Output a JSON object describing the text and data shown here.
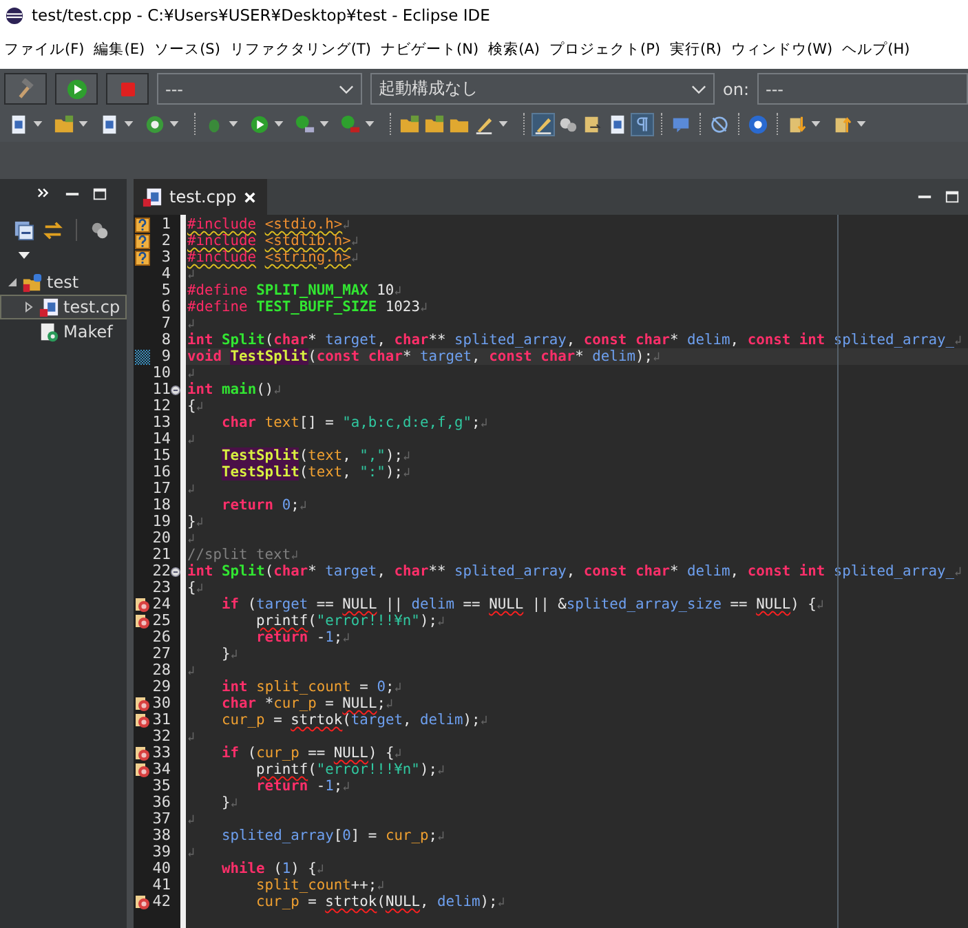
{
  "window": {
    "title": "test/test.cpp - C:¥Users¥USER¥Desktop¥test - Eclipse IDE"
  },
  "menu": [
    "ファイル(F)",
    "編集(E)",
    "ソース(S)",
    "リファクタリング(T)",
    "ナビゲート(N)",
    "検索(A)",
    "プロジェクト(P)",
    "実行(R)",
    "ウィンドウ(W)",
    "ヘルプ(H)"
  ],
  "launch_bar": {
    "mode": "---",
    "configuration": "起動構成なし",
    "target_label": "on:",
    "target": "---"
  },
  "project_explorer": {
    "tree": [
      {
        "label": "test",
        "kind": "project",
        "expanded": true,
        "selected": false,
        "children": [
          {
            "label": "test.cp",
            "kind": "source",
            "expanded": false,
            "selected": true
          },
          {
            "label": "Makef",
            "kind": "makefile",
            "selected": false
          }
        ]
      }
    ]
  },
  "editor": {
    "tab": {
      "label": "test.cpp"
    },
    "eol_mark": "↲",
    "lines": [
      {
        "number": "1",
        "problem": {
          "kind": "warning"
        },
        "tokens": [
          {
            "kind": "directive",
            "text": "#include",
            "warning_underline": true
          },
          {
            "kind": "header",
            "text": " <stdio.h>",
            "warning_underline": true
          }
        ]
      },
      {
        "number": "2",
        "problem": {
          "kind": "warning"
        },
        "tokens": [
          {
            "kind": "directive",
            "text": "#include",
            "warning_underline": true
          },
          {
            "kind": "header",
            "text": " <stdlib.h>",
            "warning_underline": true
          }
        ]
      },
      {
        "number": "3",
        "problem": {
          "kind": "warning"
        },
        "tokens": [
          {
            "kind": "directive",
            "text": "#include",
            "warning_underline": true
          },
          {
            "kind": "header",
            "text": " <string.h>",
            "warning_underline": true
          }
        ]
      },
      {
        "number": "4"
      },
      {
        "number": "5",
        "tokens": [
          {
            "kind": "directive",
            "text": "#define"
          },
          {
            "kind": "macro",
            "text": " SPLIT_NUM_MAX"
          },
          {
            "kind": "plain",
            "text": " 10"
          }
        ]
      },
      {
        "number": "6",
        "tokens": [
          {
            "kind": "directive",
            "text": "#define"
          },
          {
            "kind": "macro",
            "text": " TEST_BUFF_SIZE"
          },
          {
            "kind": "plain",
            "text": " 1023"
          }
        ]
      },
      {
        "number": "7"
      },
      {
        "number": "8",
        "tokens": [
          {
            "kind": "kw",
            "text": "int"
          },
          {
            "kind": "func",
            "text": " Split"
          },
          {
            "kind": "plain",
            "text": "("
          },
          {
            "kind": "kw",
            "text": "char"
          },
          {
            "kind": "plain",
            "text": "*"
          },
          {
            "kind": "param",
            "text": " target"
          },
          {
            "kind": "plain",
            "text": ","
          },
          {
            "kind": "kw",
            "text": " char"
          },
          {
            "kind": "plain",
            "text": "**"
          },
          {
            "kind": "param",
            "text": " splited_array"
          },
          {
            "kind": "plain",
            "text": ","
          },
          {
            "kind": "kw",
            "text": " const"
          },
          {
            "kind": "kw",
            "text": " char"
          },
          {
            "kind": "plain",
            "text": "*"
          },
          {
            "kind": "param",
            "text": " delim"
          },
          {
            "kind": "plain",
            "text": ","
          },
          {
            "kind": "kw",
            "text": " const"
          },
          {
            "kind": "kw",
            "text": " int"
          },
          {
            "kind": "param",
            "text": " splited_array_"
          }
        ]
      },
      {
        "number": "9",
        "current": true,
        "occurrence_mark": true,
        "tokens": [
          {
            "kind": "kw",
            "text": "void"
          },
          {
            "kind": "call",
            "text": " TestSplit"
          },
          {
            "kind": "plain",
            "text": "("
          },
          {
            "kind": "kw",
            "text": "const"
          },
          {
            "kind": "kw",
            "text": " char"
          },
          {
            "kind": "plain",
            "text": "*"
          },
          {
            "kind": "param",
            "text": " target"
          },
          {
            "kind": "plain",
            "text": ","
          },
          {
            "kind": "kw",
            "text": " const"
          },
          {
            "kind": "kw",
            "text": " char"
          },
          {
            "kind": "plain",
            "text": "*"
          },
          {
            "kind": "param",
            "text": " delim"
          },
          {
            "kind": "plain",
            "text": ");"
          }
        ]
      },
      {
        "number": "10"
      },
      {
        "number": "11",
        "folded": false,
        "tokens": [
          {
            "kind": "kw",
            "text": "int"
          },
          {
            "kind": "func",
            "text": " main"
          },
          {
            "kind": "plain",
            "text": "()"
          }
        ]
      },
      {
        "number": "12",
        "tokens": [
          {
            "kind": "plain",
            "text": "{"
          }
        ]
      },
      {
        "number": "13",
        "tokens": [
          {
            "kind": "kw",
            "text": "    char"
          },
          {
            "kind": "local",
            "text": " text"
          },
          {
            "kind": "plain",
            "text": "[] ="
          },
          {
            "kind": "str",
            "text": " \"a,b:c,d:e,f,g\""
          },
          {
            "kind": "plain",
            "text": ";"
          }
        ]
      },
      {
        "number": "14"
      },
      {
        "number": "15",
        "tokens": [
          {
            "kind": "call",
            "text": "    TestSplit"
          },
          {
            "kind": "plain",
            "text": "("
          },
          {
            "kind": "local",
            "text": "text"
          },
          {
            "kind": "plain",
            "text": ","
          },
          {
            "kind": "str",
            "text": " \",\""
          },
          {
            "kind": "plain",
            "text": ");"
          }
        ]
      },
      {
        "number": "16",
        "tokens": [
          {
            "kind": "call",
            "text": "    TestSplit"
          },
          {
            "kind": "plain",
            "text": "("
          },
          {
            "kind": "local",
            "text": "text"
          },
          {
            "kind": "plain",
            "text": ","
          },
          {
            "kind": "str",
            "text": " \":\""
          },
          {
            "kind": "plain",
            "text": ");"
          }
        ]
      },
      {
        "number": "17"
      },
      {
        "number": "18",
        "tokens": [
          {
            "kind": "kw",
            "text": "    return"
          },
          {
            "kind": "num",
            "text": " 0"
          },
          {
            "kind": "plain",
            "text": ";"
          }
        ]
      },
      {
        "number": "19",
        "tokens": [
          {
            "kind": "plain",
            "text": "}"
          }
        ]
      },
      {
        "number": "20"
      },
      {
        "number": "21",
        "tokens": [
          {
            "kind": "comment",
            "text": "//split text"
          }
        ]
      },
      {
        "number": "22",
        "folded": false,
        "tokens": [
          {
            "kind": "kw",
            "text": "int"
          },
          {
            "kind": "func",
            "text": " Split"
          },
          {
            "kind": "plain",
            "text": "("
          },
          {
            "kind": "kw",
            "text": "char"
          },
          {
            "kind": "plain",
            "text": "*"
          },
          {
            "kind": "param",
            "text": " target"
          },
          {
            "kind": "plain",
            "text": ","
          },
          {
            "kind": "kw",
            "text": " char"
          },
          {
            "kind": "plain",
            "text": "**"
          },
          {
            "kind": "param",
            "text": " splited_array"
          },
          {
            "kind": "plain",
            "text": ","
          },
          {
            "kind": "kw",
            "text": " const"
          },
          {
            "kind": "kw",
            "text": " char"
          },
          {
            "kind": "plain",
            "text": "*"
          },
          {
            "kind": "param",
            "text": " delim"
          },
          {
            "kind": "plain",
            "text": ","
          },
          {
            "kind": "kw",
            "text": " const"
          },
          {
            "kind": "kw",
            "text": " int"
          },
          {
            "kind": "param",
            "text": " splited_array_"
          }
        ]
      },
      {
        "number": "23",
        "tokens": [
          {
            "kind": "plain",
            "text": "{"
          }
        ]
      },
      {
        "number": "24",
        "problem": {
          "kind": "error"
        },
        "tokens": [
          {
            "kind": "kw",
            "text": "    if"
          },
          {
            "kind": "plain",
            "text": " ("
          },
          {
            "kind": "param",
            "text": "target"
          },
          {
            "kind": "plain",
            "text": " =="
          },
          {
            "kind": "plain",
            "text": " NULL",
            "error_underline": true
          },
          {
            "kind": "plain",
            "text": " ||"
          },
          {
            "kind": "param",
            "text": " delim"
          },
          {
            "kind": "plain",
            "text": " =="
          },
          {
            "kind": "plain",
            "text": " NULL",
            "error_underline": true
          },
          {
            "kind": "plain",
            "text": " || &"
          },
          {
            "kind": "param",
            "text": "splited_array_size"
          },
          {
            "kind": "plain",
            "text": " =="
          },
          {
            "kind": "plain",
            "text": " NULL",
            "error_underline": true
          },
          {
            "kind": "plain",
            "text": ") {"
          }
        ]
      },
      {
        "number": "25",
        "problem": {
          "kind": "error"
        },
        "tokens": [
          {
            "kind": "plain",
            "text": "        printf",
            "error_underline": true
          },
          {
            "kind": "plain",
            "text": "("
          },
          {
            "kind": "str",
            "text": "\"error!!!¥n\""
          },
          {
            "kind": "plain",
            "text": ");"
          }
        ]
      },
      {
        "number": "26",
        "tokens": [
          {
            "kind": "kw",
            "text": "        return"
          },
          {
            "kind": "plain",
            "text": " -"
          },
          {
            "kind": "num",
            "text": "1"
          },
          {
            "kind": "plain",
            "text": ";"
          }
        ]
      },
      {
        "number": "27",
        "tokens": [
          {
            "kind": "plain",
            "text": "    }"
          }
        ]
      },
      {
        "number": "28"
      },
      {
        "number": "29",
        "tokens": [
          {
            "kind": "kw",
            "text": "    int"
          },
          {
            "kind": "local",
            "text": " split_count"
          },
          {
            "kind": "plain",
            "text": " ="
          },
          {
            "kind": "num",
            "text": " 0"
          },
          {
            "kind": "plain",
            "text": ";"
          }
        ]
      },
      {
        "number": "30",
        "problem": {
          "kind": "error"
        },
        "tokens": [
          {
            "kind": "kw",
            "text": "    char"
          },
          {
            "kind": "plain",
            "text": " *"
          },
          {
            "kind": "local",
            "text": "cur_p"
          },
          {
            "kind": "plain",
            "text": " ="
          },
          {
            "kind": "plain",
            "text": " NULL",
            "error_underline": true
          },
          {
            "kind": "plain",
            "text": ";"
          }
        ]
      },
      {
        "number": "31",
        "problem": {
          "kind": "error"
        },
        "tokens": [
          {
            "kind": "local",
            "text": "    cur_p"
          },
          {
            "kind": "plain",
            "text": " ="
          },
          {
            "kind": "plain",
            "text": " strtok",
            "error_underline": true
          },
          {
            "kind": "plain",
            "text": "("
          },
          {
            "kind": "param",
            "text": "target"
          },
          {
            "kind": "plain",
            "text": ","
          },
          {
            "kind": "param",
            "text": " delim"
          },
          {
            "kind": "plain",
            "text": ");"
          }
        ]
      },
      {
        "number": "32"
      },
      {
        "number": "33",
        "problem": {
          "kind": "error"
        },
        "tokens": [
          {
            "kind": "kw",
            "text": "    if"
          },
          {
            "kind": "plain",
            "text": " ("
          },
          {
            "kind": "local",
            "text": "cur_p"
          },
          {
            "kind": "plain",
            "text": " =="
          },
          {
            "kind": "plain",
            "text": " NULL",
            "error_underline": true
          },
          {
            "kind": "plain",
            "text": ") {"
          }
        ]
      },
      {
        "number": "34",
        "problem": {
          "kind": "error"
        },
        "tokens": [
          {
            "kind": "plain",
            "text": "        printf",
            "error_underline": true
          },
          {
            "kind": "plain",
            "text": "("
          },
          {
            "kind": "str",
            "text": "\"error!!!¥n\""
          },
          {
            "kind": "plain",
            "text": ");"
          }
        ]
      },
      {
        "number": "35",
        "tokens": [
          {
            "kind": "kw",
            "text": "        return"
          },
          {
            "kind": "plain",
            "text": " -"
          },
          {
            "kind": "num",
            "text": "1"
          },
          {
            "kind": "plain",
            "text": ";"
          }
        ]
      },
      {
        "number": "36",
        "tokens": [
          {
            "kind": "plain",
            "text": "    }"
          }
        ]
      },
      {
        "number": "37"
      },
      {
        "number": "38",
        "tokens": [
          {
            "kind": "param",
            "text": "    splited_array"
          },
          {
            "kind": "plain",
            "text": "["
          },
          {
            "kind": "num",
            "text": "0"
          },
          {
            "kind": "plain",
            "text": "] ="
          },
          {
            "kind": "local",
            "text": " cur_p"
          },
          {
            "kind": "plain",
            "text": ";"
          }
        ]
      },
      {
        "number": "39"
      },
      {
        "number": "40",
        "tokens": [
          {
            "kind": "kw",
            "text": "    while"
          },
          {
            "kind": "plain",
            "text": " ("
          },
          {
            "kind": "num",
            "text": "1"
          },
          {
            "kind": "plain",
            "text": ") {"
          }
        ]
      },
      {
        "number": "41",
        "tokens": [
          {
            "kind": "local",
            "text": "        split_count"
          },
          {
            "kind": "plain",
            "text": "++;"
          }
        ]
      },
      {
        "number": "42",
        "problem": {
          "kind": "error"
        },
        "tokens": [
          {
            "kind": "local",
            "text": "        cur_p"
          },
          {
            "kind": "plain",
            "text": " ="
          },
          {
            "kind": "plain",
            "text": " strtok",
            "error_underline": true
          },
          {
            "kind": "plain",
            "text": "("
          },
          {
            "kind": "plain",
            "text": "NULL",
            "error_underline": true
          },
          {
            "kind": "plain",
            "text": ","
          },
          {
            "kind": "param",
            "text": " delim"
          },
          {
            "kind": "plain",
            "text": ");"
          }
        ]
      }
    ]
  }
}
